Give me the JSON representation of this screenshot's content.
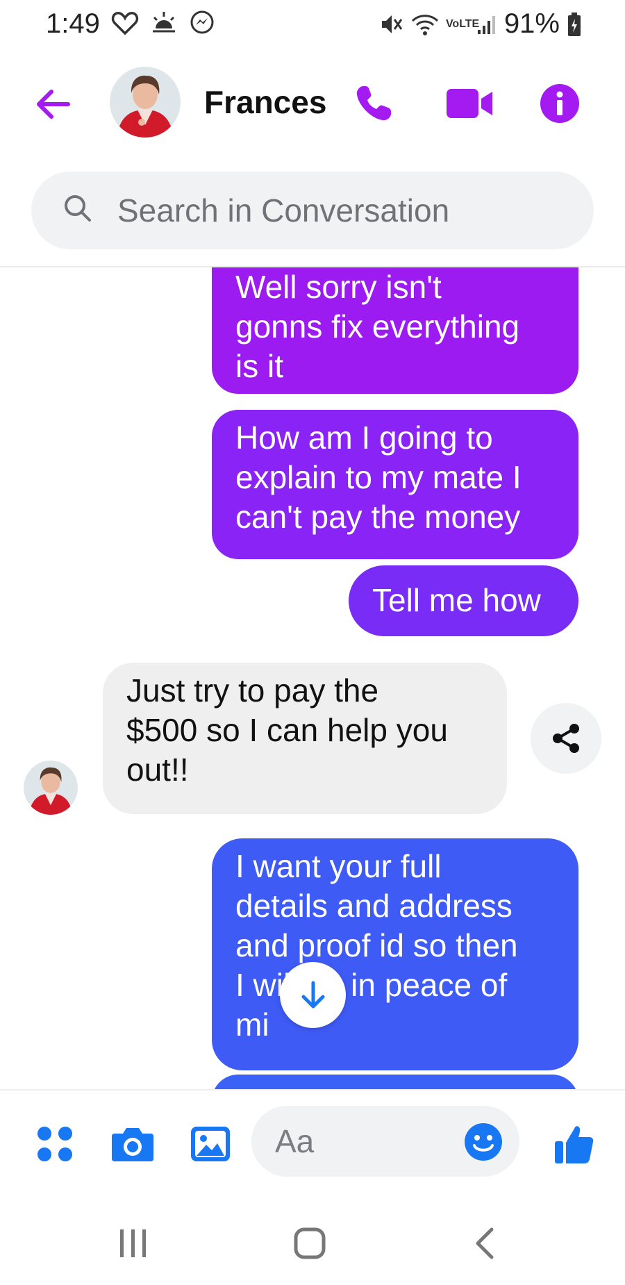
{
  "status_bar": {
    "time": "1:49",
    "battery": "91%",
    "network": "VoLTE"
  },
  "header": {
    "contact_name": "Frances",
    "back_icon": "arrow-left-icon",
    "call_icon": "phone-icon",
    "video_icon": "video-camera-icon",
    "info_icon": "info-icon"
  },
  "search": {
    "placeholder": "Search in Conversation"
  },
  "messages": [
    {
      "direction": "outgoing",
      "lines": [
        "Well sorry isn't",
        "gonns fix everything",
        "is it"
      ]
    },
    {
      "direction": "outgoing",
      "lines": [
        "How am I going to",
        "explain to my mate I",
        "can't pay the money"
      ]
    },
    {
      "direction": "outgoing",
      "lines": [
        "Tell me how"
      ]
    },
    {
      "direction": "incoming",
      "lines": [
        "Just try to pay the",
        "$500 so I can help you",
        "out!!"
      ]
    },
    {
      "direction": "outgoing",
      "lines": [
        "I want your full",
        "details and address",
        "and proof id so then",
        "I will be in peace of",
        "mi"
      ]
    }
  ],
  "composer": {
    "placeholder": "Aa",
    "icons": [
      "apps-grid-icon",
      "camera-icon",
      "gallery-icon",
      "emoji-icon",
      "thumbs-up-icon"
    ]
  },
  "colors": {
    "accent_purple": "#a31bf0",
    "accent_blue": "#1877f2",
    "bubble_1": "#9c1bf0",
    "bubble_2": "#8a23f5",
    "bubble_3": "#7a2cf7",
    "bubble_incoming": "#efefef",
    "bubble_5": "#3f5bf6"
  }
}
